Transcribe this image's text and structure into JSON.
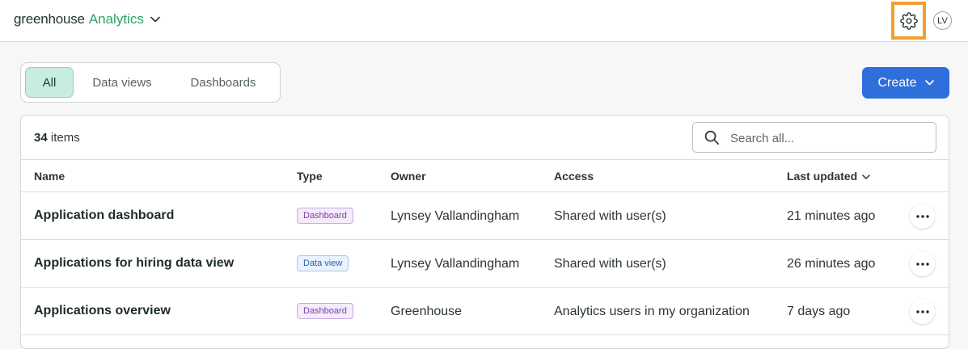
{
  "app": {
    "brand_primary": "greenhouse",
    "brand_secondary": "Analytics",
    "avatar_initials": "LV"
  },
  "filters": {
    "tabs": [
      {
        "label": "All",
        "active": true
      },
      {
        "label": "Data views",
        "active": false
      },
      {
        "label": "Dashboards",
        "active": false
      }
    ]
  },
  "toolbar": {
    "create_label": "Create"
  },
  "list": {
    "count": "34",
    "count_suffix": "items",
    "search_placeholder": "Search all...",
    "columns": {
      "name": "Name",
      "type": "Type",
      "owner": "Owner",
      "access": "Access",
      "last_updated": "Last updated"
    },
    "rows": [
      {
        "name": "Application dashboard",
        "type": "Dashboard",
        "owner": "Lynsey Vallandingham",
        "access": "Shared with user(s)",
        "updated": "21 minutes ago"
      },
      {
        "name": "Applications for hiring data view",
        "type": "Data view",
        "owner": "Lynsey Vallandingham",
        "access": "Shared with user(s)",
        "updated": "26 minutes ago"
      },
      {
        "name": "Applications overview",
        "type": "Dashboard",
        "owner": "Greenhouse",
        "access": "Analytics users in my organization",
        "updated": "7 days ago"
      }
    ]
  },
  "colors": {
    "brand_green": "#26a367",
    "primary_blue": "#2f6fdc",
    "highlight_orange": "#f2a02f",
    "active_tab_bg": "#c7ece0"
  },
  "icons": {
    "brand_menu": "chevron-down-icon",
    "settings": "gear-icon",
    "search": "search-icon",
    "sort": "chevron-down-icon",
    "row_menu": "more-horizontal-icon"
  }
}
